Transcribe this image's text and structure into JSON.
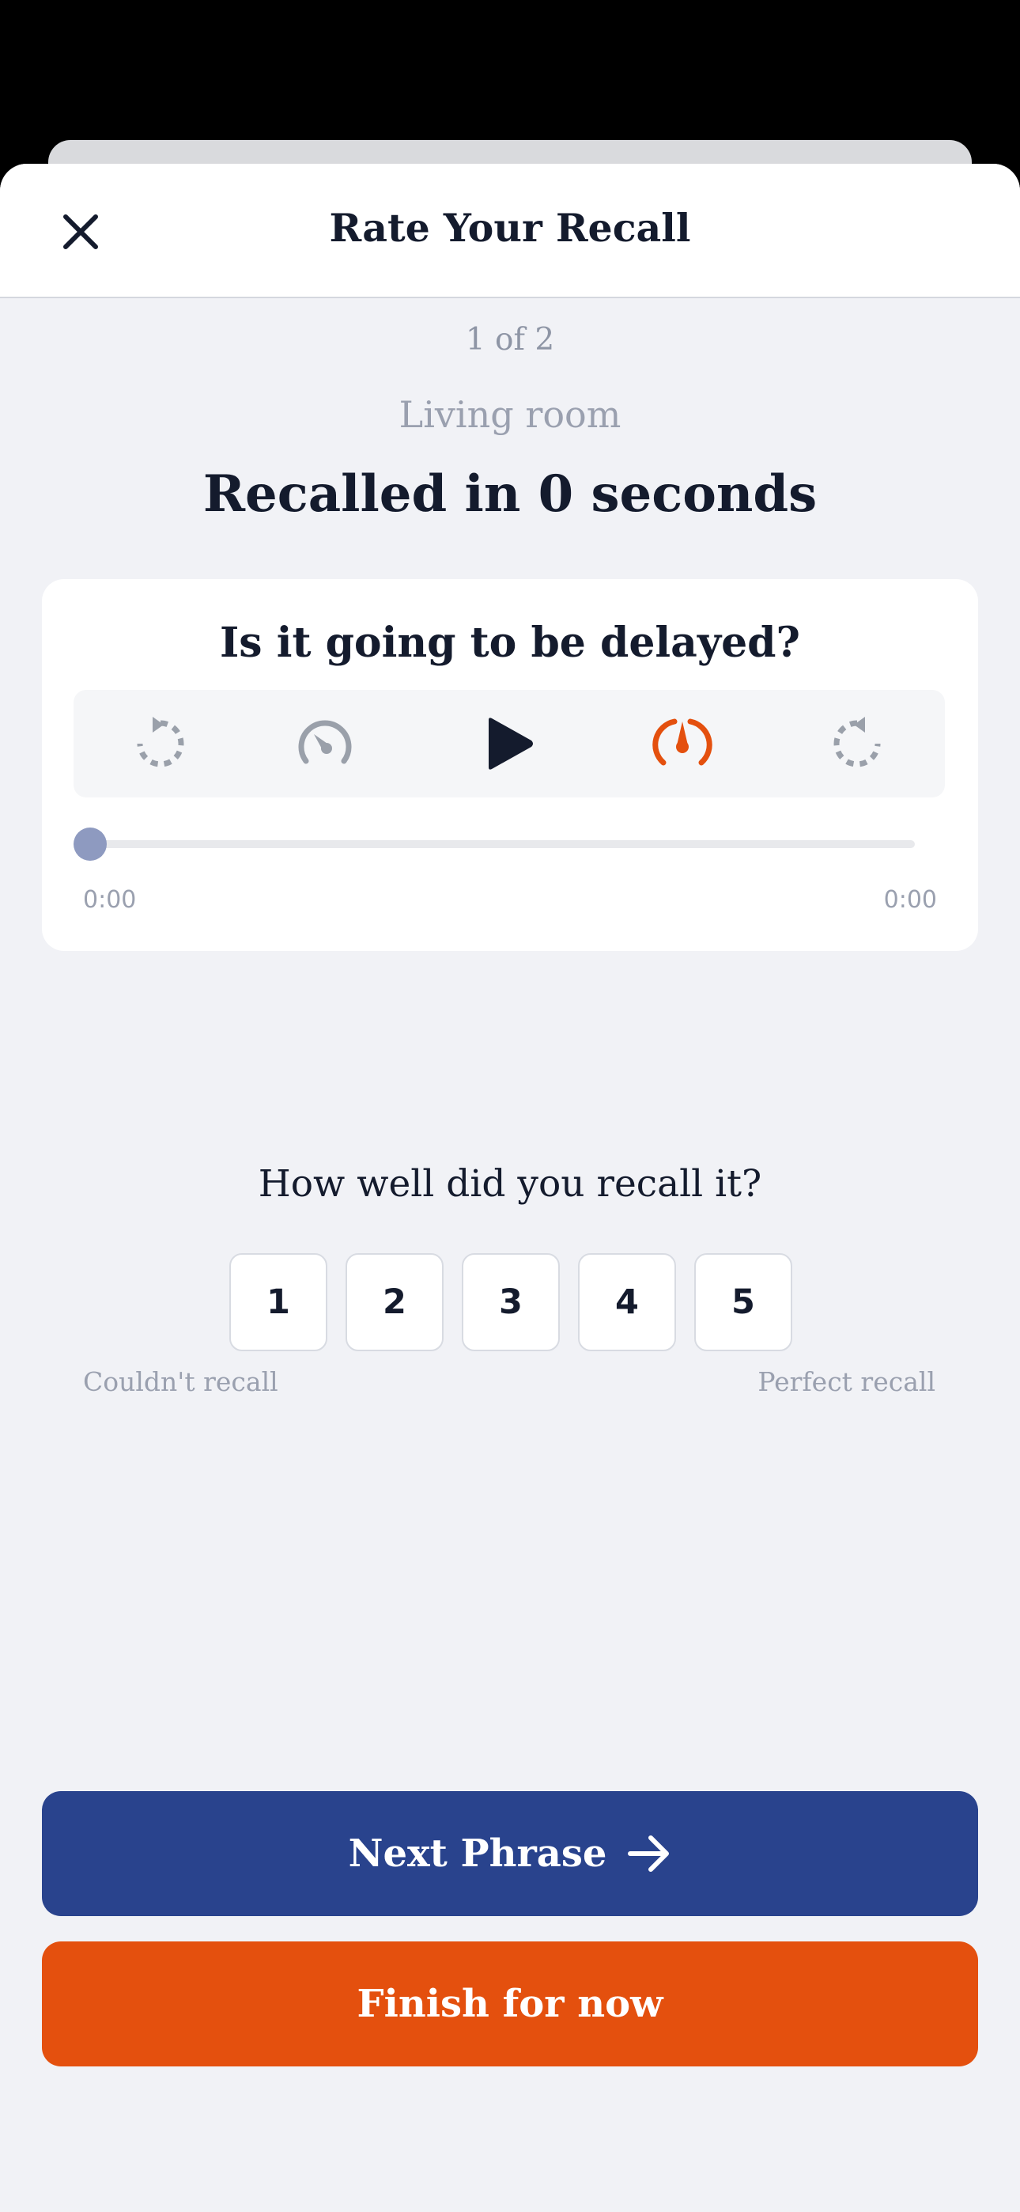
{
  "header": {
    "title": "Rate Your Recall"
  },
  "progress": {
    "text": "1 of 2",
    "current": 1,
    "total": 2
  },
  "phrase": {
    "label": "Living room",
    "recall_time": "Recalled in 0 seconds"
  },
  "player": {
    "question": "Is it going to be delayed?",
    "position_fraction": 0,
    "time_start": "0:00",
    "time_end": "0:00",
    "controls": [
      "rewind-icon",
      "speedometer-icon",
      "play-icon",
      "speed-gauge-active-icon",
      "forward-icon"
    ]
  },
  "rating": {
    "question": "How well did you recall it?",
    "options": [
      "1",
      "2",
      "3",
      "4",
      "5"
    ],
    "low_label": "Couldn't recall",
    "high_label": "Perfect recall"
  },
  "actions": {
    "next_label": "Next Phrase",
    "finish_label": "Finish for now"
  },
  "colors": {
    "primary": "#29438d",
    "accent": "#e4500e",
    "text": "#141b2d",
    "muted": "#9aa0af"
  }
}
